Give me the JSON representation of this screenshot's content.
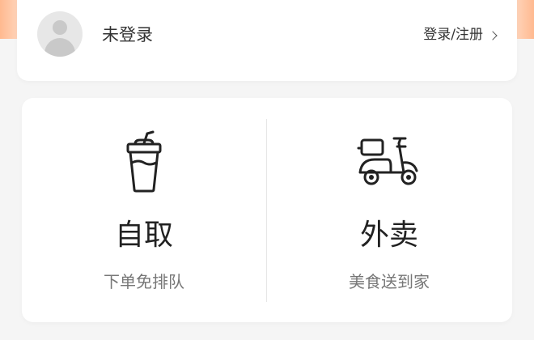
{
  "user": {
    "status": "未登录",
    "login_link": "登录/注册"
  },
  "services": [
    {
      "title": "自取",
      "subtitle": "下单免排队",
      "icon": "drink-cup-icon"
    },
    {
      "title": "外卖",
      "subtitle": "美食送到家",
      "icon": "scooter-icon"
    }
  ],
  "colors": {
    "accent": "#ffb98f",
    "background": "#f5f5f5",
    "card": "#ffffff",
    "text_primary": "#222222",
    "text_secondary": "#777777"
  }
}
